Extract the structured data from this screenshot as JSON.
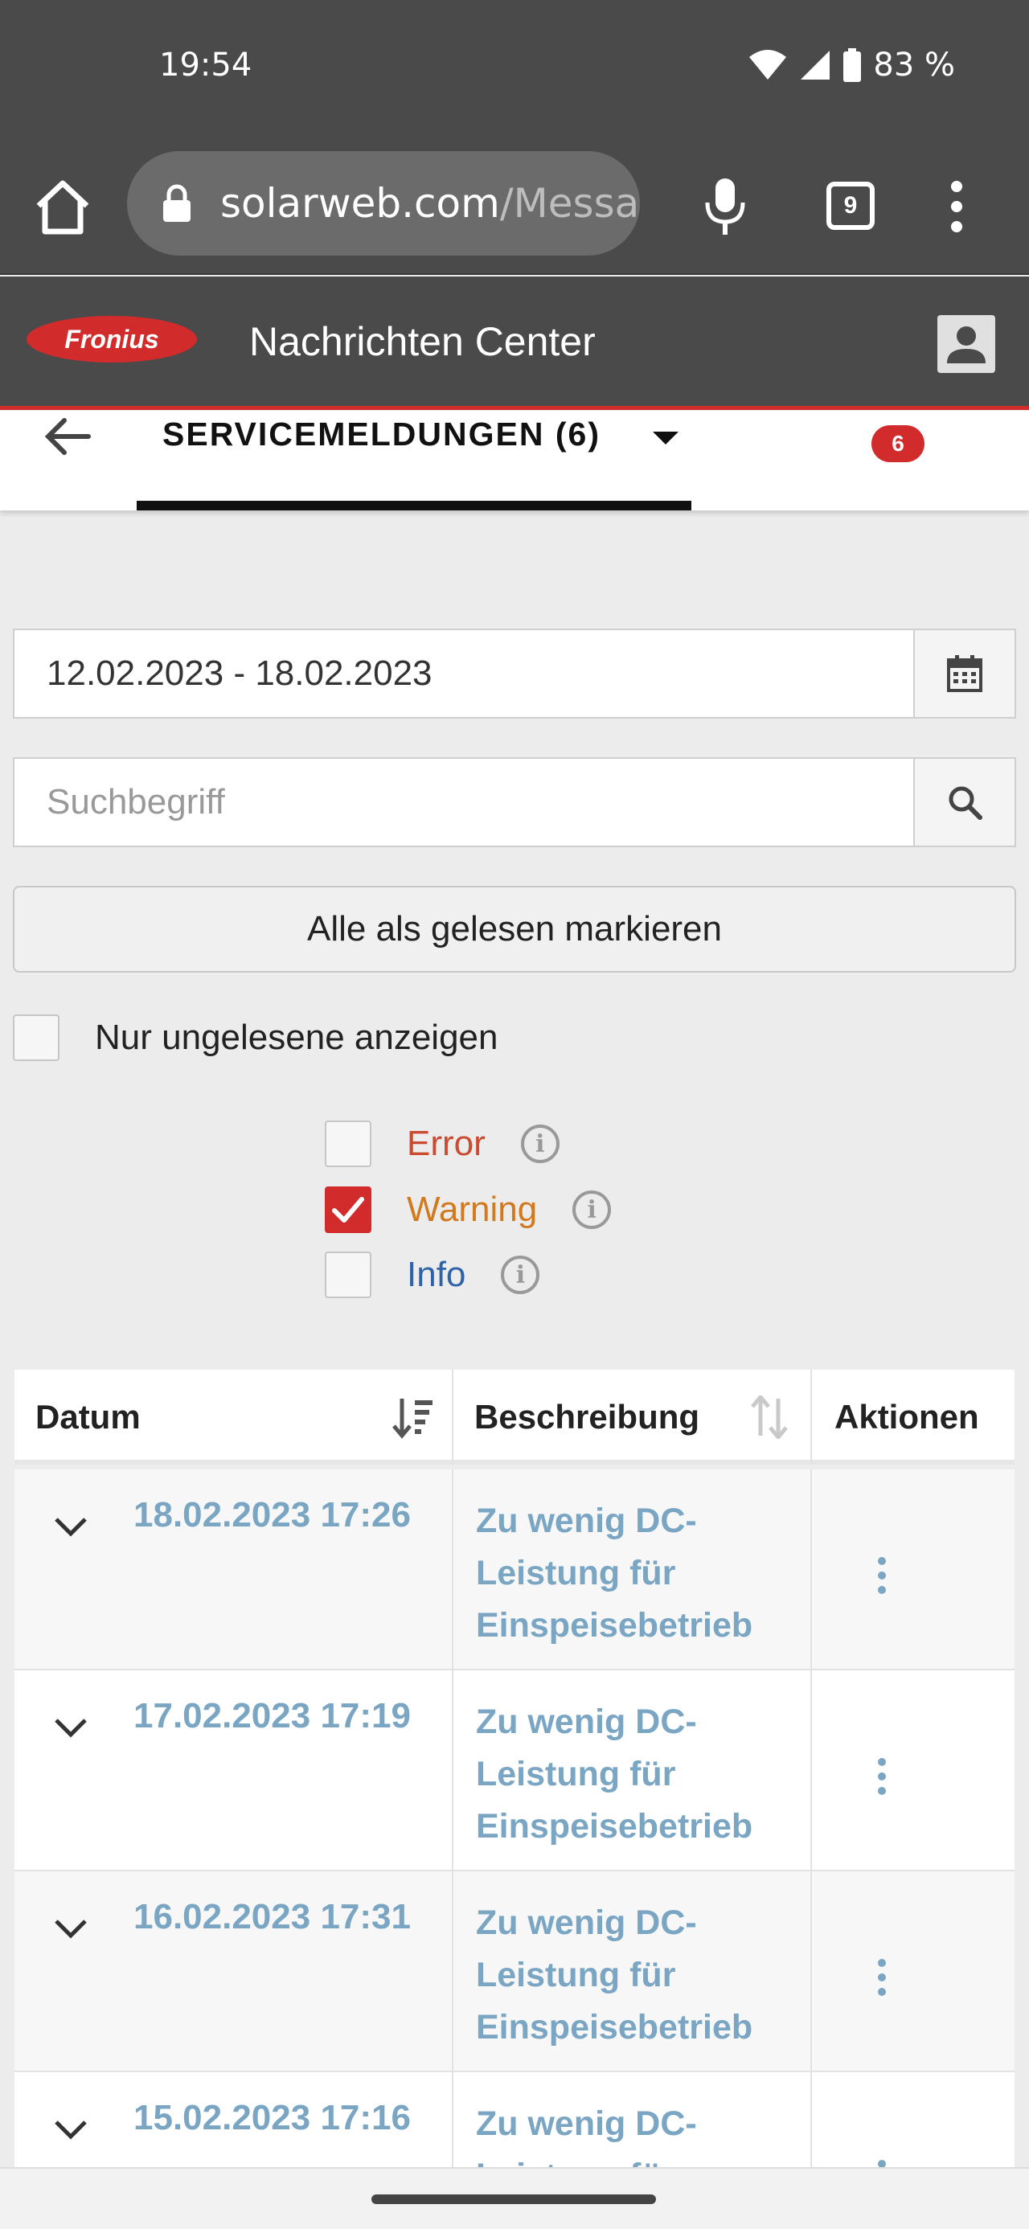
{
  "status": {
    "time": "19:54",
    "battery": "83 %"
  },
  "browser": {
    "url_host": "solarweb.com",
    "url_path": "/Messa",
    "tab_count": "9"
  },
  "app": {
    "title": "Nachrichten Center",
    "logo_text": "Fronius"
  },
  "tab": {
    "label": "SERVICEMELDUNGEN (6)",
    "badge": "6"
  },
  "filters": {
    "date_range": "12.02.2023 - 18.02.2023",
    "search_placeholder": "Suchbegriff",
    "mark_all_label": "Alle als gelesen markieren",
    "unread_only_label": "Nur ungelesene anzeigen",
    "levels": [
      {
        "label": "Error",
        "checked": false,
        "color": "#cc4a2f"
      },
      {
        "label": "Warning",
        "checked": true,
        "color": "#d2781d"
      },
      {
        "label": "Info",
        "checked": false,
        "color": "#2f63a8"
      }
    ]
  },
  "table": {
    "columns": [
      "Datum",
      "Beschreibung",
      "Aktionen"
    ],
    "rows": [
      {
        "date": "18.02.2023 17:26",
        "description": "Zu wenig DC-Leistung für Einspeisebetrieb"
      },
      {
        "date": "17.02.2023 17:19",
        "description": "Zu wenig DC-Leistung für Einspeisebetrieb"
      },
      {
        "date": "16.02.2023 17:31",
        "description": "Zu wenig DC-Leistung für Einspeisebetrieb"
      },
      {
        "date": "15.02.2023 17:16",
        "description": "Zu wenig DC-Leistung für Einspeisebetrieb"
      }
    ]
  },
  "colors": {
    "accent": "#d22b2b",
    "link": "#7aa6c4",
    "header_bg": "#4a4a4a"
  }
}
